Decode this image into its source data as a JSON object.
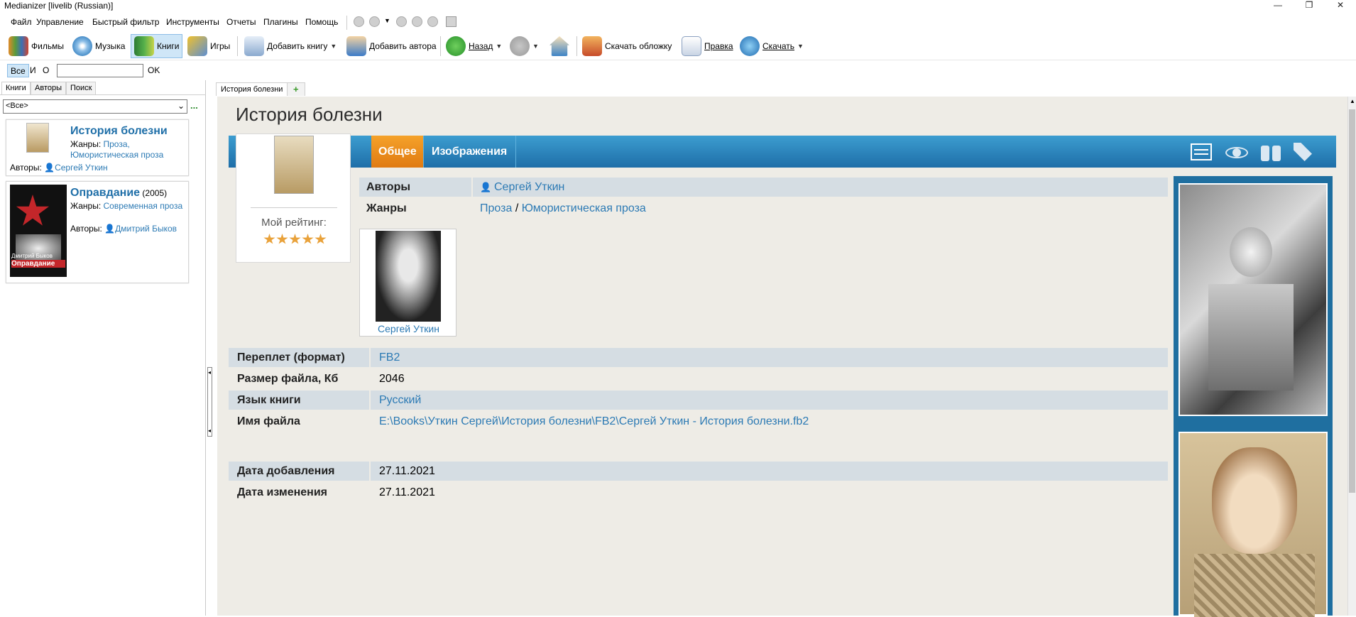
{
  "window": {
    "title": "Medianizer [livelib (Russian)]",
    "controls": {
      "minimize": "—",
      "restore": "❐",
      "close": "✕"
    }
  },
  "menu": [
    "Файл",
    "Управление",
    "Быстрый фильтр",
    "Инструменты",
    "Отчеты",
    "Плагины",
    "Помощь"
  ],
  "toolbar": {
    "films": "Фильмы",
    "music": "Музыка",
    "books": "Книги",
    "games": "Игры",
    "add_book": "Добавить книгу",
    "add_author": "Добавить автора",
    "back": "Назад",
    "download_cover": "Скачать обложку",
    "edit": "Правка",
    "download": "Скачать"
  },
  "filter": {
    "all": "Все",
    "and": "И",
    "or": "О",
    "value": "",
    "ok": "OK"
  },
  "left_tabs": [
    "Книги",
    "Авторы",
    "Поиск"
  ],
  "combo_value": "<Все>",
  "combo_more": "...",
  "books": [
    {
      "title": "История болезни",
      "genres_label": "Жанры:",
      "genres": "Проза, Юмористическая проза",
      "authors_label": "Авторы:",
      "author": "Сергей Уткин"
    },
    {
      "title": "Оправдание",
      "year": "(2005)",
      "genres_label": "Жанры:",
      "genres": "Современная проза",
      "authors_label": "Авторы:",
      "author": "Дмитрий Быков",
      "cover_text": "Оправдание",
      "cover_author": "Дмитрий Быков"
    }
  ],
  "right_tabs": {
    "current": "История болезни",
    "add": "+"
  },
  "detail": {
    "title": "История болезни",
    "tabs": {
      "general": "Общее",
      "images": "Изображения"
    },
    "my_rating_label": "Мой рейтинг:",
    "rating": 5,
    "authors_label": "Авторы",
    "authors_value": "Сергей Уткин",
    "genres_label": "Жанры",
    "genre_1": "Проза",
    "genre_sep": "/",
    "genre_2": "Юмористическая проза",
    "author_photo_caption": "Сергей Уткин",
    "fields": [
      {
        "label": "Переплет (формат)",
        "value": "FB2",
        "link": true
      },
      {
        "label": "Размер файла, Кб",
        "value": "2046",
        "link": false
      },
      {
        "label": "Язык книги",
        "value": "Русский",
        "link": true
      },
      {
        "label": "Имя файла",
        "value": "E:\\Books\\Уткин Сергей\\История болезни\\FB2\\Сергей Уткин - История болезни.fb2",
        "link": true
      }
    ],
    "dates": [
      {
        "label": "Дата добавления",
        "value": "27.11.2021"
      },
      {
        "label": "Дата изменения",
        "value": "27.11.2021"
      }
    ]
  },
  "colors": {
    "accent_blue": "#2c7ab4",
    "band_blue": "#2b86bf",
    "active_orange": "#ee8e1e",
    "stripe": "#d5dde3"
  }
}
